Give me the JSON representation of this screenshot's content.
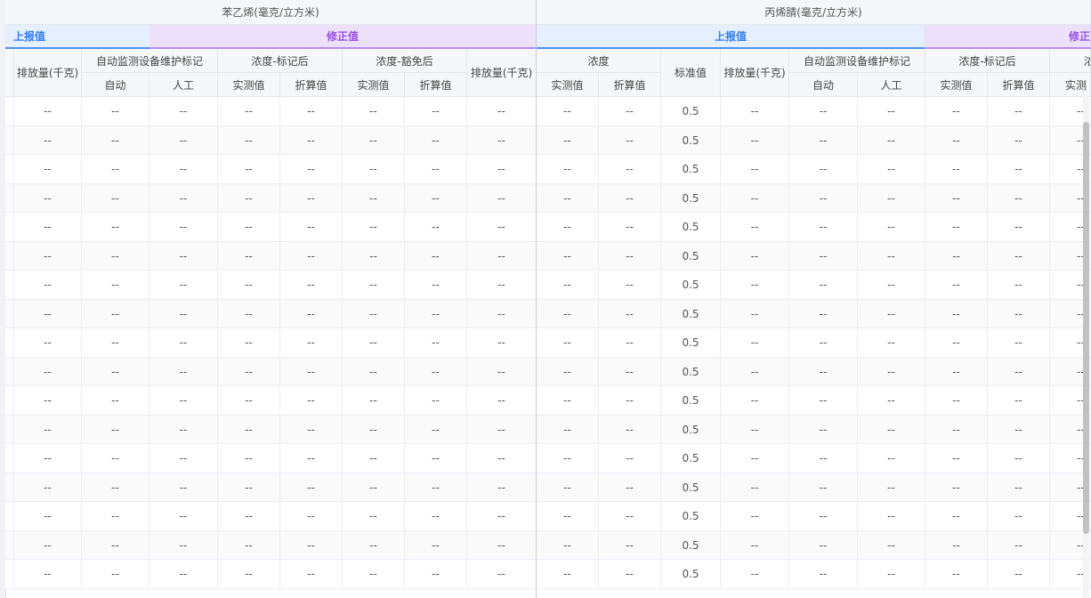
{
  "groups": [
    {
      "title": "苯乙烯(毫克/立方米)"
    },
    {
      "title": "丙烯腈(毫克/立方米)"
    }
  ],
  "bands": {
    "reported": "上报值",
    "corrected": "修正值",
    "corrected_cut_start": "修正"
  },
  "labels": {
    "emission_kg": "排放量(千克)",
    "maint_mark": "自动监测设备维护标记",
    "auto": "自动",
    "manual": "人工",
    "conc_after_mark": "浓度-标记后",
    "conc_after_exempt": "浓度-豁免后",
    "concentration": "浓度",
    "measured": "实测值",
    "converted": "折算值",
    "standard": "标准值",
    "measured_cut": "实测",
    "conc_cut": "浓"
  },
  "rows": [
    {
      "g1": [
        "--",
        "--",
        "--",
        "--",
        "--",
        "--",
        "--",
        "--"
      ],
      "g2": [
        "--",
        "--",
        "0.5",
        "--",
        "--",
        "--",
        "--",
        "--",
        "--"
      ]
    },
    {
      "g1": [
        "--",
        "--",
        "--",
        "--",
        "--",
        "--",
        "--",
        "--"
      ],
      "g2": [
        "--",
        "--",
        "0.5",
        "--",
        "--",
        "--",
        "--",
        "--",
        "--"
      ]
    },
    {
      "g1": [
        "--",
        "--",
        "--",
        "--",
        "--",
        "--",
        "--",
        "--"
      ],
      "g2": [
        "--",
        "--",
        "0.5",
        "--",
        "--",
        "--",
        "--",
        "--",
        "--"
      ]
    },
    {
      "g1": [
        "--",
        "--",
        "--",
        "--",
        "--",
        "--",
        "--",
        "--"
      ],
      "g2": [
        "--",
        "--",
        "0.5",
        "--",
        "--",
        "--",
        "--",
        "--",
        "--"
      ]
    },
    {
      "g1": [
        "--",
        "--",
        "--",
        "--",
        "--",
        "--",
        "--",
        "--"
      ],
      "g2": [
        "--",
        "--",
        "0.5",
        "--",
        "--",
        "--",
        "--",
        "--",
        "--"
      ]
    },
    {
      "g1": [
        "--",
        "--",
        "--",
        "--",
        "--",
        "--",
        "--",
        "--"
      ],
      "g2": [
        "--",
        "--",
        "0.5",
        "--",
        "--",
        "--",
        "--",
        "--",
        "--"
      ]
    },
    {
      "g1": [
        "--",
        "--",
        "--",
        "--",
        "--",
        "--",
        "--",
        "--"
      ],
      "g2": [
        "--",
        "--",
        "0.5",
        "--",
        "--",
        "--",
        "--",
        "--",
        "--"
      ]
    },
    {
      "g1": [
        "--",
        "--",
        "--",
        "--",
        "--",
        "--",
        "--",
        "--"
      ],
      "g2": [
        "--",
        "--",
        "0.5",
        "--",
        "--",
        "--",
        "--",
        "--",
        "--"
      ]
    },
    {
      "g1": [
        "--",
        "--",
        "--",
        "--",
        "--",
        "--",
        "--",
        "--"
      ],
      "g2": [
        "--",
        "--",
        "0.5",
        "--",
        "--",
        "--",
        "--",
        "--",
        "--"
      ]
    },
    {
      "g1": [
        "--",
        "--",
        "--",
        "--",
        "--",
        "--",
        "--",
        "--"
      ],
      "g2": [
        "--",
        "--",
        "0.5",
        "--",
        "--",
        "--",
        "--",
        "--",
        "--"
      ]
    },
    {
      "g1": [
        "--",
        "--",
        "--",
        "--",
        "--",
        "--",
        "--",
        "--"
      ],
      "g2": [
        "--",
        "--",
        "0.5",
        "--",
        "--",
        "--",
        "--",
        "--",
        "--"
      ]
    },
    {
      "g1": [
        "--",
        "--",
        "--",
        "--",
        "--",
        "--",
        "--",
        "--"
      ],
      "g2": [
        "--",
        "--",
        "0.5",
        "--",
        "--",
        "--",
        "--",
        "--",
        "--"
      ]
    },
    {
      "g1": [
        "--",
        "--",
        "--",
        "--",
        "--",
        "--",
        "--",
        "--"
      ],
      "g2": [
        "--",
        "--",
        "0.5",
        "--",
        "--",
        "--",
        "--",
        "--",
        "--"
      ]
    },
    {
      "g1": [
        "--",
        "--",
        "--",
        "--",
        "--",
        "--",
        "--",
        "--"
      ],
      "g2": [
        "--",
        "--",
        "0.5",
        "--",
        "--",
        "--",
        "--",
        "--",
        "--"
      ]
    },
    {
      "g1": [
        "--",
        "--",
        "--",
        "--",
        "--",
        "--",
        "--",
        "--"
      ],
      "g2": [
        "--",
        "--",
        "0.5",
        "--",
        "--",
        "--",
        "--",
        "--",
        "--"
      ]
    },
    {
      "g1": [
        "--",
        "--",
        "--",
        "--",
        "--",
        "--",
        "--",
        "--"
      ],
      "g2": [
        "--",
        "--",
        "0.5",
        "--",
        "--",
        "--",
        "--",
        "--",
        "--"
      ]
    },
    {
      "g1": [
        "--",
        "--",
        "--",
        "--",
        "--",
        "--",
        "--",
        "--"
      ],
      "g2": [
        "--",
        "--",
        "0.5",
        "--",
        "--",
        "--",
        "--",
        "--",
        "--"
      ]
    }
  ]
}
